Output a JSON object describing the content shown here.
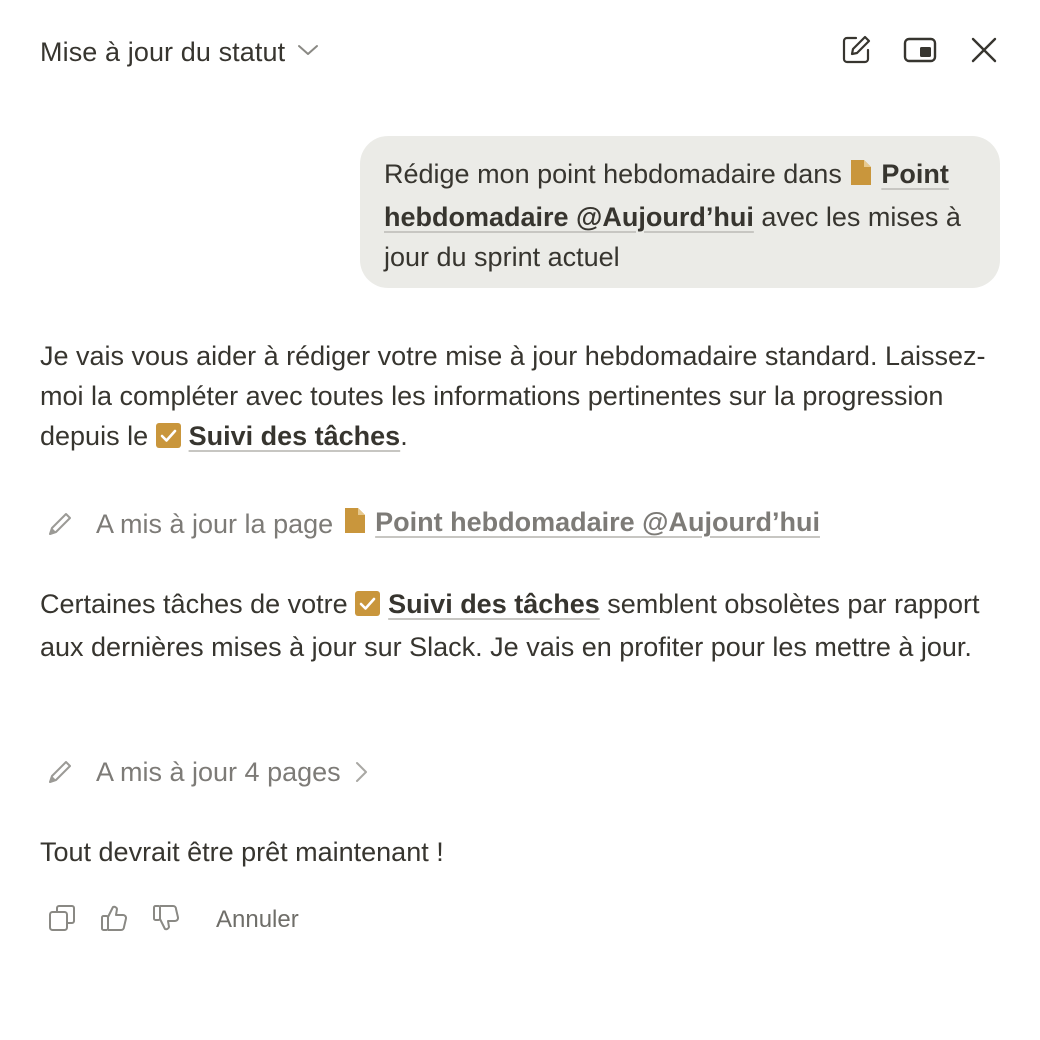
{
  "header": {
    "title": "Mise à jour du statut",
    "icons": [
      "chevron-down-icon",
      "compose-icon",
      "picture-in-picture-icon",
      "close-icon"
    ]
  },
  "user_message": {
    "before": "Rédige mon point hebdomadaire dans ",
    "mention": "Point hebdomadaire @Aujourd’hui",
    "after": " avec les mises à jour du sprint actuel"
  },
  "assistant": {
    "paragraph1": {
      "before": "Je vais vous aider à rédiger votre mise à jour hebdomadaire standard. Laissez-moi la compléter avec toutes les informations pertinentes sur la progression depuis le ",
      "mention": "Suivi des tâches",
      "after": "."
    },
    "action1": {
      "text": "A mis à jour la page",
      "mention": "Point hebdomadaire @Aujourd’hui"
    },
    "paragraph2": {
      "before": "Certaines tâches de votre ",
      "mention": "Suivi des tâches",
      "after": " semblent obsolètes par rapport aux dernières mises à jour sur Slack. Je vais en profiter pour les mettre à jour."
    },
    "action2": {
      "text": "A mis à jour 4 pages"
    },
    "paragraph3": "Tout devrait être prêt maintenant !"
  },
  "feedback": {
    "undo_label": "Annuler",
    "icons": [
      "copy-icon",
      "thumbs-up-icon",
      "thumbs-down-icon"
    ]
  },
  "colors": {
    "text": "#37352f",
    "muted": "#7d7b77",
    "bubble": "#ebebe7",
    "accent": "#c9963c"
  }
}
